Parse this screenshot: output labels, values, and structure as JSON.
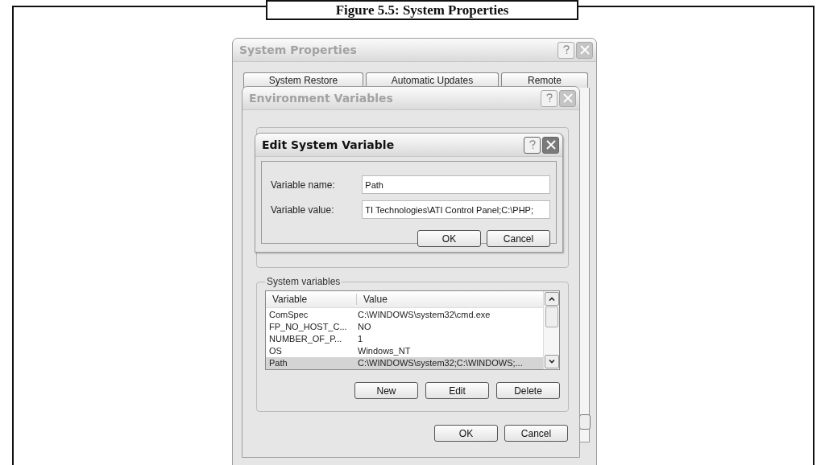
{
  "figure": {
    "caption": "Figure 5.5: System Properties"
  },
  "system_properties": {
    "title": "System Properties",
    "active": false,
    "tabs": [
      {
        "label": "System Restore",
        "selected": false
      },
      {
        "label": "Automatic Updates",
        "selected": false
      },
      {
        "label": "Remote",
        "selected": false
      }
    ]
  },
  "environment_variables": {
    "title": "Environment Variables",
    "active": false,
    "system_variables": {
      "label": "System variables",
      "columns": [
        "Variable",
        "Value"
      ],
      "rows": [
        {
          "variable": "ComSpec",
          "value": "C:\\WINDOWS\\system32\\cmd.exe",
          "selected": false
        },
        {
          "variable": "FP_NO_HOST_C...",
          "value": "NO",
          "selected": false
        },
        {
          "variable": "NUMBER_OF_P...",
          "value": "1",
          "selected": false
        },
        {
          "variable": "OS",
          "value": "Windows_NT",
          "selected": false
        },
        {
          "variable": "Path",
          "value": "C:\\WINDOWS\\system32;C:\\WINDOWS;...",
          "selected": true
        }
      ]
    },
    "list_buttons": [
      "New",
      "Edit",
      "Delete"
    ],
    "buttons": [
      "OK",
      "Cancel"
    ]
  },
  "edit_dialog": {
    "title": "Edit System Variable",
    "active": true,
    "fields": [
      {
        "label": "Variable name:",
        "value": "Path"
      },
      {
        "label": "Variable value:",
        "value": "TI Technologies\\ATI Control Panel;C:\\PHP;"
      }
    ],
    "buttons": [
      "OK",
      "Cancel"
    ]
  }
}
